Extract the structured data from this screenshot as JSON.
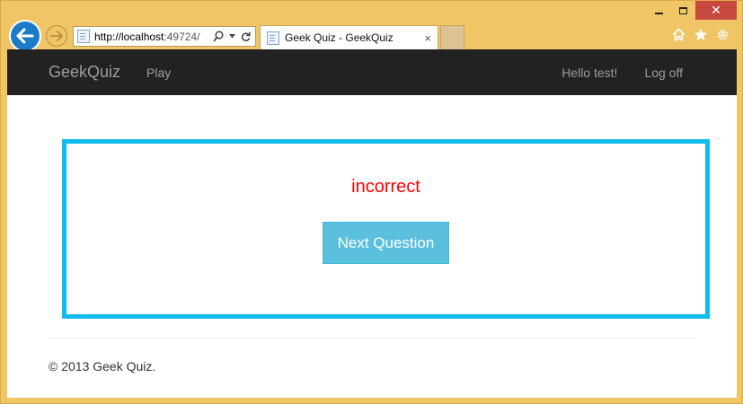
{
  "browser": {
    "address": {
      "host": "http://localhost",
      "rest": ":49724/"
    },
    "tab": {
      "title": "Geek Quiz - GeekQuiz",
      "close": "×"
    },
    "caption": {
      "close": "✕"
    }
  },
  "navbar": {
    "brand": "GeekQuiz",
    "links": [
      "Play"
    ],
    "right_links": [
      "Hello test!",
      "Log off"
    ]
  },
  "quiz": {
    "result_text": "incorrect",
    "result_color": "#ff0000",
    "next_button_label": "Next Question",
    "next_button_color": "#5bc0de",
    "border_color": "#0fbcec"
  },
  "footer": {
    "text": "© 2013 Geek Quiz."
  }
}
